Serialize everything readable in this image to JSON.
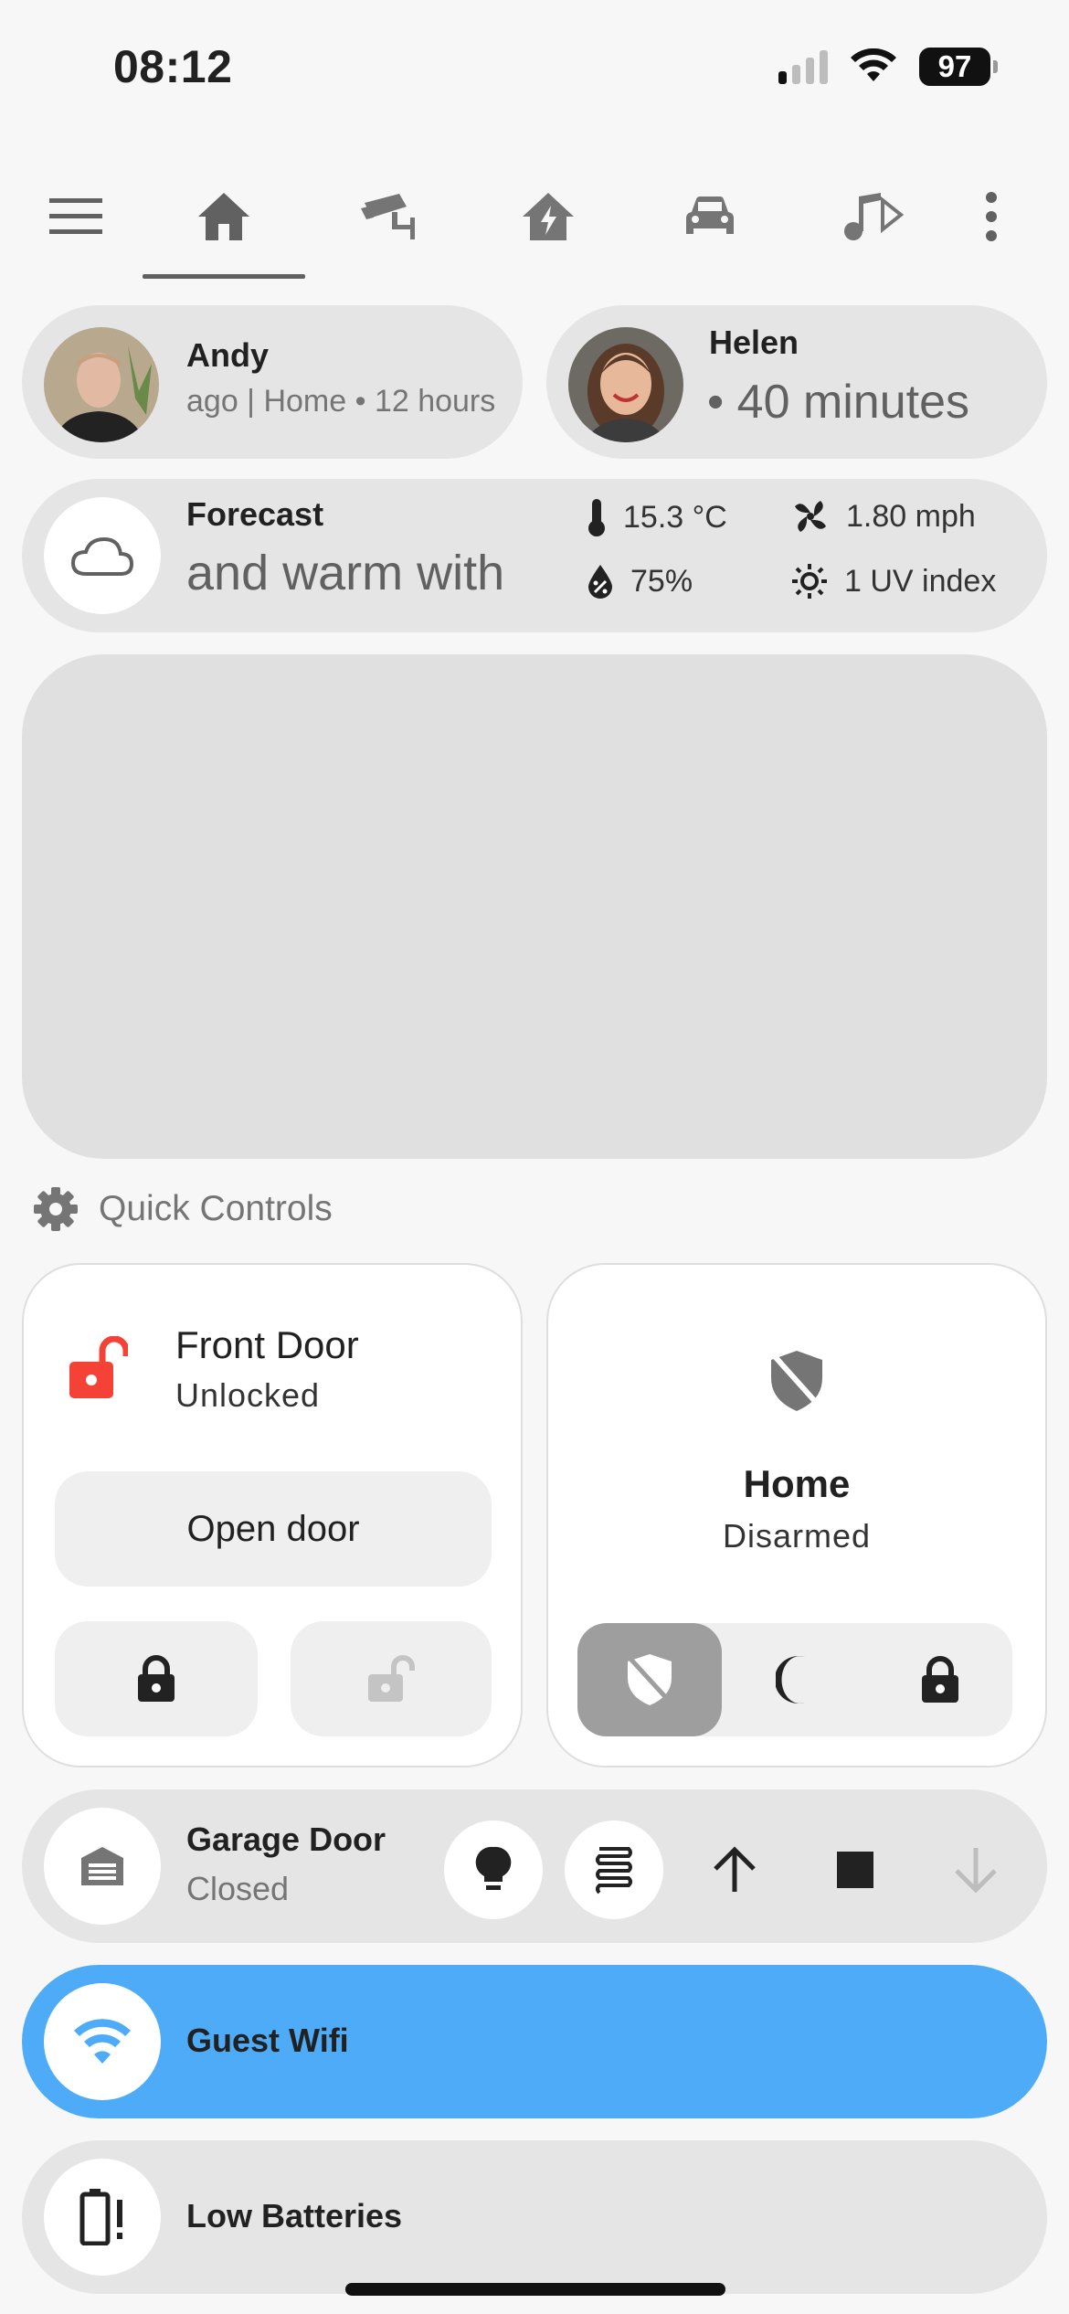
{
  "status_bar": {
    "time": "08:12",
    "battery": "97"
  },
  "tabs": [
    {
      "name": "menu",
      "icon": "menu-icon"
    },
    {
      "name": "home",
      "icon": "home-icon",
      "active": true
    },
    {
      "name": "security",
      "icon": "cctv-icon"
    },
    {
      "name": "energy",
      "icon": "home-lightning-icon"
    },
    {
      "name": "car",
      "icon": "car-icon"
    },
    {
      "name": "media",
      "icon": "music-icon"
    },
    {
      "name": "more",
      "icon": "dots-vertical-icon"
    }
  ],
  "people": [
    {
      "name": "Andy",
      "status": "ago  |  Home • 12 hours"
    },
    {
      "name": "Helen",
      "status": "• 40 minutes"
    }
  ],
  "weather": {
    "title": "Forecast",
    "condition": "and warm with",
    "temperature": "15.3 °C",
    "wind": "1.80 mph",
    "humidity": "75%",
    "uv": "1 UV index"
  },
  "quick_controls": {
    "title": "Quick Controls",
    "front_door": {
      "name": "Front Door",
      "state": "Unlocked",
      "open_label": "Open door",
      "accent": "#f44336"
    },
    "alarm": {
      "name": "Home",
      "state": "Disarmed"
    }
  },
  "garage": {
    "name": "Garage Door",
    "state": "Closed"
  },
  "guest_wifi": {
    "name": "Guest Wifi",
    "color": "#4dabf7"
  },
  "low_batteries": {
    "name": "Low Batteries"
  }
}
